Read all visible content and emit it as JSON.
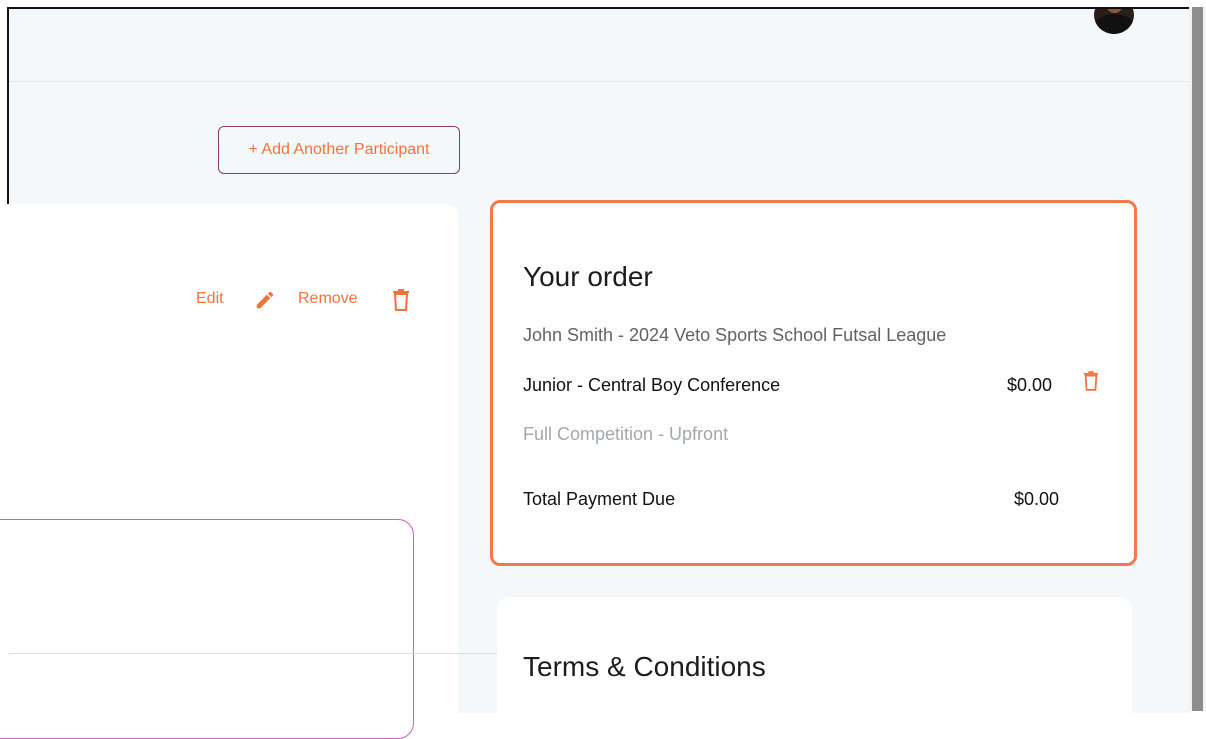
{
  "toolbar": {
    "add_participant_label": "+ Add Another Participant"
  },
  "participant_card": {
    "edit_label": "Edit",
    "remove_label": "Remove"
  },
  "order": {
    "title": "Your order",
    "participant_line": "John Smith - 2024 Veto Sports School Futsal League",
    "item_name": "Junior - Central Boy Conference",
    "item_price": "$0.00",
    "item_subtitle": "Full Competition - Upfront",
    "total_label": "Total Payment Due",
    "total_value": "$0.00"
  },
  "terms": {
    "title": "Terms & Conditions"
  },
  "icons": {
    "edit": "pencil-icon",
    "remove": "trash-icon",
    "item_remove": "trash-icon",
    "avatar": "user-avatar"
  },
  "colors": {
    "accent": "#f2733a",
    "order_border": "#f07a4d",
    "button_border": "#8a3f63",
    "inner_card_border": "#d65cc6",
    "page_bg": "#f5f8fb"
  }
}
